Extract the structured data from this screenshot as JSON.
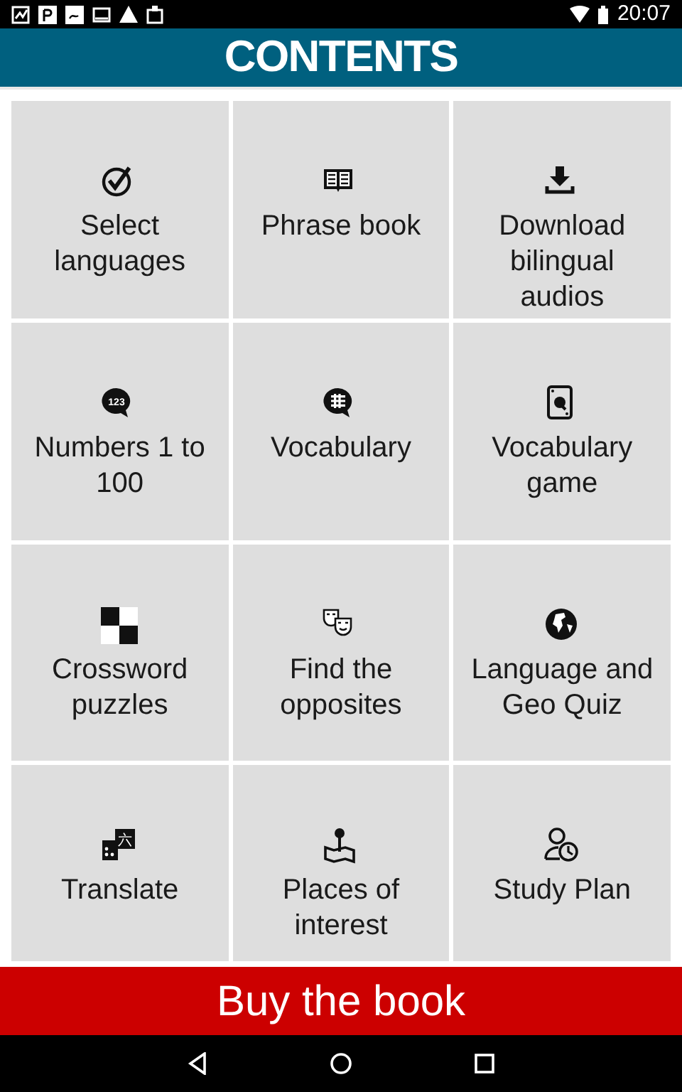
{
  "status_bar": {
    "time": "20:07"
  },
  "header": {
    "title": "CONTENTS"
  },
  "tiles": [
    {
      "label": "Select languages"
    },
    {
      "label": "Phrase book"
    },
    {
      "label": "Download bilingual audios"
    },
    {
      "label": "Numbers 1 to 100",
      "icon_text": "123"
    },
    {
      "label": "Vocabulary"
    },
    {
      "label": "Vocabulary game"
    },
    {
      "label": "Crossword puzzles"
    },
    {
      "label": "Find the opposites"
    },
    {
      "label": "Language and Geo Quiz"
    },
    {
      "label": "Translate",
      "icon_text": "六"
    },
    {
      "label": "Places of interest"
    },
    {
      "label": "Study Plan"
    }
  ],
  "buy_button": {
    "label": "Buy the book"
  }
}
